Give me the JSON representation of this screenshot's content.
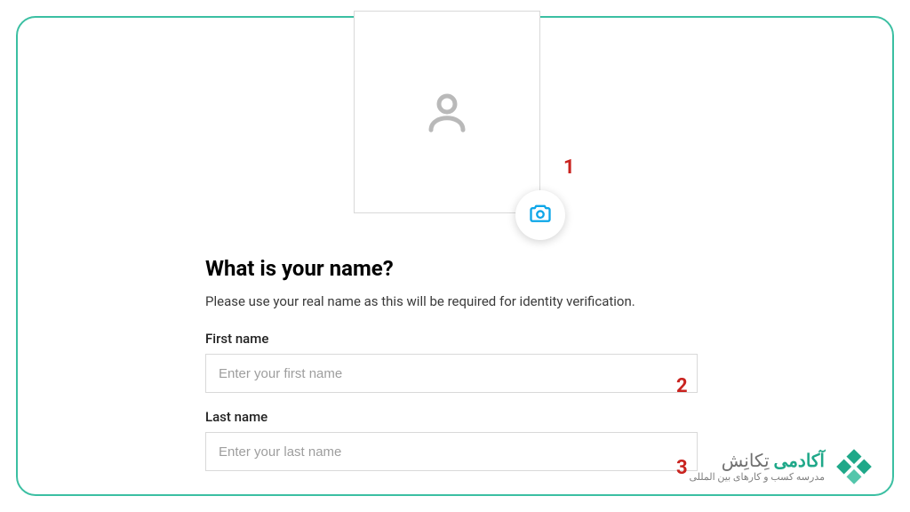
{
  "avatar": {
    "camera_icon": "camera"
  },
  "form": {
    "heading": "What is your name?",
    "subheading": "Please use your real name as this will be required for identity verification.",
    "first_name": {
      "label": "First name",
      "placeholder": "Enter your first name",
      "value": ""
    },
    "last_name": {
      "label": "Last name",
      "placeholder": "Enter your last name",
      "value": ""
    }
  },
  "annotations": {
    "a1": "1",
    "a2": "2",
    "a3": "3"
  },
  "brand": {
    "main_bold": "آکادمی",
    "main_light": "تِکانِش",
    "sub": "مدرسه کسب و کارهای بین المللی"
  },
  "colors": {
    "frame_border": "#3bbfa2",
    "annotation": "#c9231f",
    "camera_icon": "#0da6e8",
    "brand_green": "#1fa889"
  }
}
